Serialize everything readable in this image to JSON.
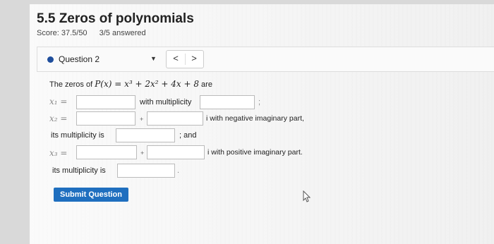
{
  "header": {
    "title": "5.5 Zeros of polynomials",
    "score": "Score: 37.5/50",
    "answered": "3/5 answered"
  },
  "question_nav": {
    "label": "Question 2",
    "prev": "<",
    "next": ">"
  },
  "question": {
    "intro_prefix": "The zeros of",
    "polynomial": "P(x) = x³ + 2x² + 4x + 8",
    "intro_suffix": "are",
    "x1_label": "x₁ =",
    "with_multiplicity": "with multiplicity",
    "semicolon": ";",
    "x2_label": "x₂ =",
    "plus": "+",
    "neg_imag_text": "i with negative imaginary part,",
    "its_multiplicity_is": "its multiplicity is",
    "and_text": "; and",
    "x3_label": "x₃ =",
    "pos_imag_text": "i with positive imaginary part.",
    "period": "."
  },
  "inputs": {
    "x1": "",
    "x1_mult": "",
    "x2_real": "",
    "x2_imag": "",
    "x2_mult": "",
    "x3_real": "",
    "x3_imag": "",
    "x3_mult": ""
  },
  "submit_label": "Submit Question",
  "colors": {
    "accent": "#1f6fbf",
    "dot": "#1f4e9c"
  }
}
